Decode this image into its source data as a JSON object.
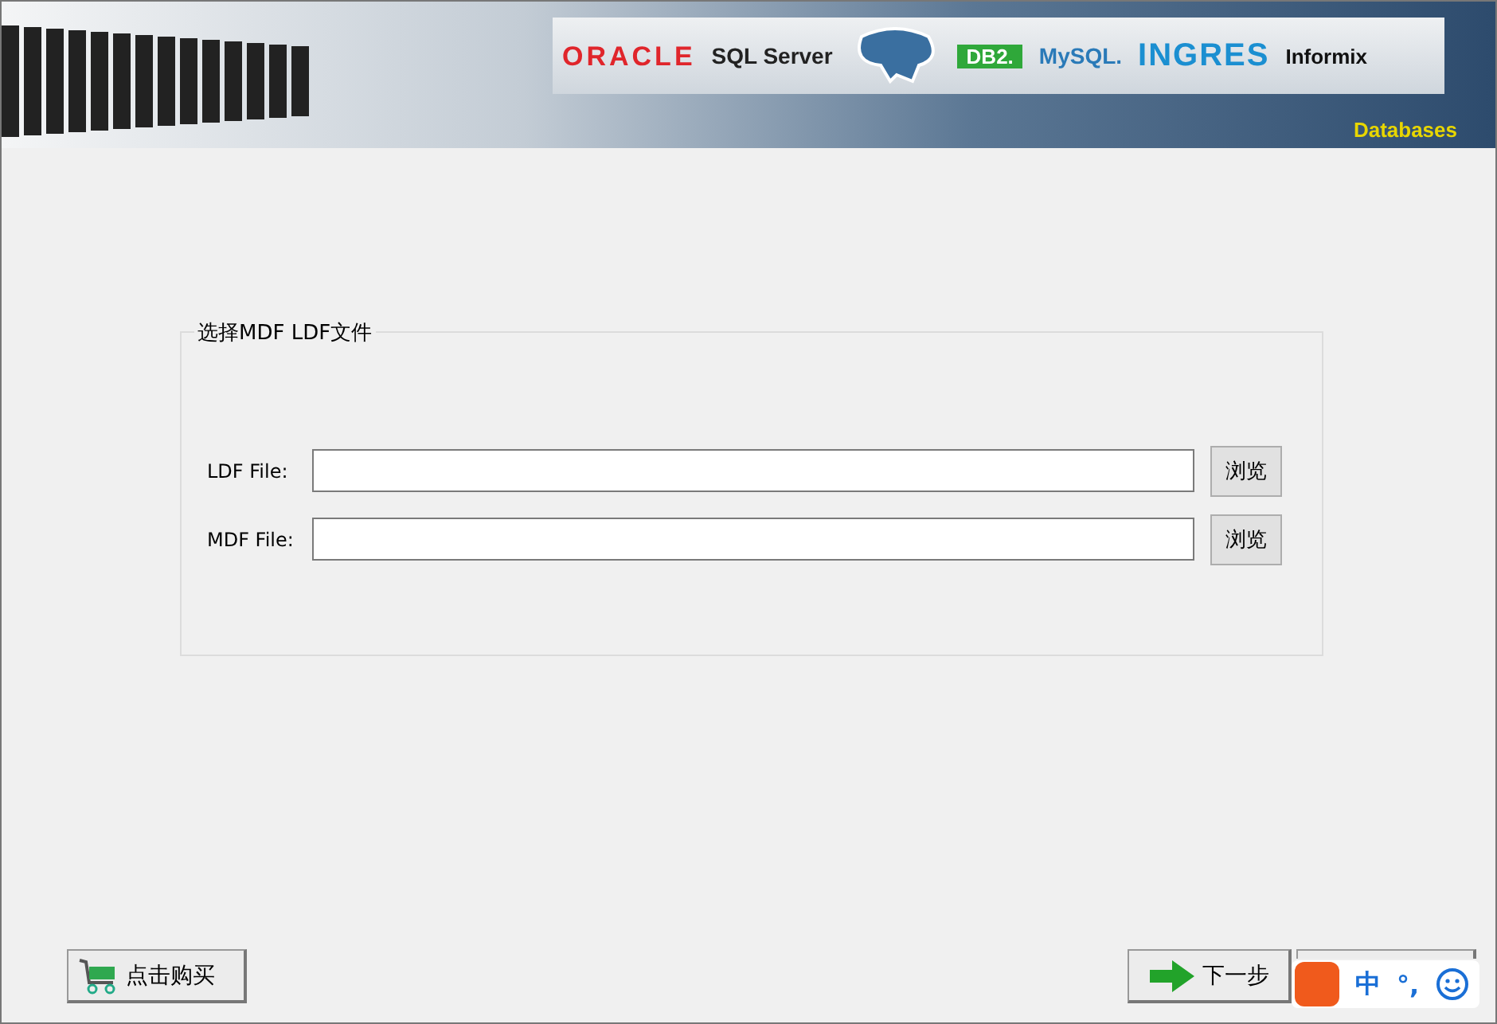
{
  "banner": {
    "logos": [
      {
        "kind": "oracle",
        "text": "ORACLE"
      },
      {
        "kind": "sqlserver",
        "text": "SQL Server"
      },
      {
        "kind": "db2",
        "text": "DB2."
      },
      {
        "kind": "mysql",
        "text": "MySQL."
      },
      {
        "kind": "ingres",
        "text": "INGRES"
      },
      {
        "kind": "informix",
        "text": "Informix"
      }
    ],
    "caption": "Databases"
  },
  "group": {
    "title": "选择MDF LDF文件",
    "rows": [
      {
        "label": "LDF File:",
        "button": "浏览"
      },
      {
        "label": "MDF File:",
        "button": "浏览"
      }
    ]
  },
  "buy_button": "点击购买",
  "next_button": "下一步",
  "ime_bar": {
    "mode": "中",
    "punct": "°,"
  }
}
